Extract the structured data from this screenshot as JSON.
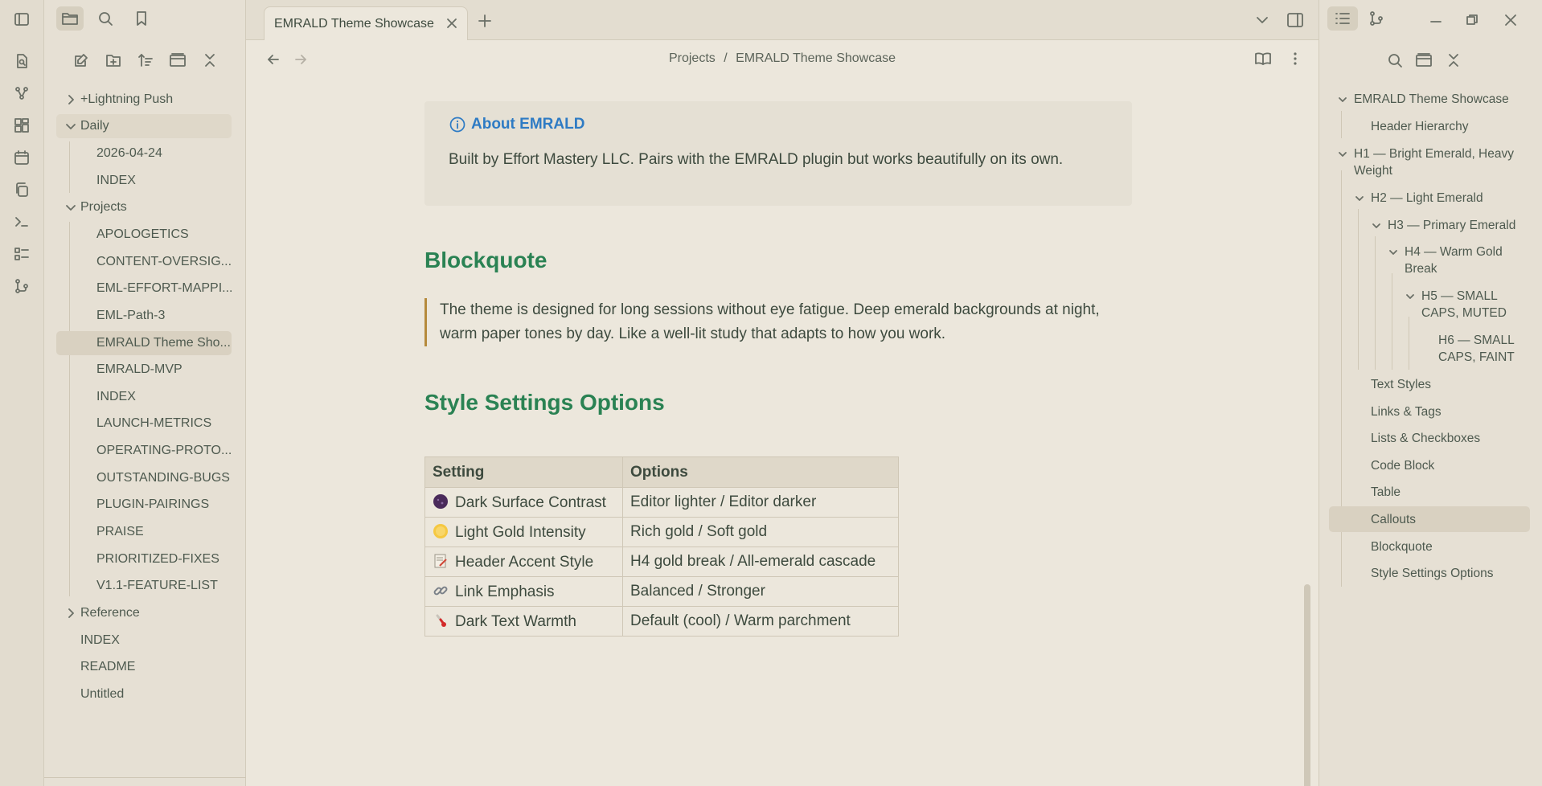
{
  "tab": {
    "title": "EMRALD Theme Showcase"
  },
  "breadcrumb": {
    "folder": "Projects",
    "sep": "/",
    "file": "EMRALD Theme Showcase"
  },
  "file_tree": {
    "lightning": "+Lightning Push",
    "daily": "Daily",
    "daily_items": [
      "2026-04-24",
      "INDEX"
    ],
    "projects": "Projects",
    "project_items": [
      "APOLOGETICS",
      "CONTENT-OVERSIG...",
      "EML-EFFORT-MAPPI...",
      "EML-Path-3",
      "EMRALD Theme Sho...",
      "EMRALD-MVP",
      "INDEX",
      "LAUNCH-METRICS",
      "OPERATING-PROTO...",
      "OUTSTANDING-BUGS",
      "PLUGIN-PAIRINGS",
      "PRAISE",
      "PRIORITIZED-FIXES",
      "V1.1-FEATURE-LIST"
    ],
    "reference": "Reference",
    "root_items": [
      "INDEX",
      "README",
      "Untitled"
    ]
  },
  "callout": {
    "title": "About EMRALD",
    "body": "Built by Effort Mastery LLC. Pairs with the EMRALD plugin but works beautifully on its own."
  },
  "blockquote": {
    "heading": "Blockquote",
    "text": "The theme is designed for long sessions without eye fatigue. Deep emerald backgrounds at night, warm paper tones by day. Like a well-lit study that adapts to how you work."
  },
  "style_settings": {
    "heading": "Style Settings Options",
    "headers": [
      "Setting",
      "Options"
    ],
    "rows": [
      {
        "icon": "purple-circle-icon",
        "setting": "Dark Surface Contrast",
        "options": "Editor lighter / Editor darker"
      },
      {
        "icon": "yellow-circle-icon",
        "setting": "Light Gold Intensity",
        "options": "Rich gold / Soft gold"
      },
      {
        "icon": "memo-icon",
        "setting": "Header Accent Style",
        "options": "H4 gold break / All-emerald cascade"
      },
      {
        "icon": "link-icon",
        "setting": "Link Emphasis",
        "options": "Balanced / Stronger"
      },
      {
        "icon": "thermometer-icon",
        "setting": "Dark Text Warmth",
        "options": "Default (cool) / Warm parchment"
      }
    ]
  },
  "outline": {
    "items": [
      "EMRALD Theme Showcase",
      "Header Hierarchy",
      "H1 — Bright Emerald, Heavy",
      "Weight",
      "H2 — Light Emerald",
      "H3 — Primary Emerald",
      "H4 — Warm Gold",
      "Break",
      "H5 — SMALL",
      "CAPS, MUTED",
      "H6 — SMALL",
      "CAPS, FAINT",
      "Text Styles",
      "Links & Tags",
      "Lists & Checkboxes",
      "Code Block",
      "Table",
      "Callouts",
      "Blockquote",
      "Style Settings Options"
    ],
    "selected": "Callouts"
  },
  "colors": {
    "accent": "#2a8253",
    "callout": "#2e7bc4",
    "quote_border": "#b58a3c",
    "background": "#ece7dc"
  }
}
